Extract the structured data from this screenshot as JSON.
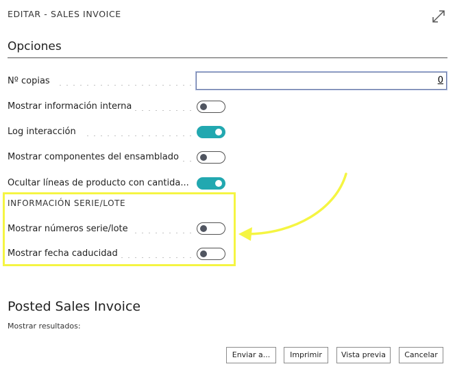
{
  "dialog": {
    "title": "EDITAR - SALES INVOICE"
  },
  "options": {
    "section_title": "Opciones",
    "copies": {
      "label": "Nº copias",
      "value": "0"
    },
    "toggles": [
      {
        "label": "Mostrar información interna",
        "state": "off"
      },
      {
        "label": "Log interacción",
        "state": "on"
      },
      {
        "label": "Mostrar componentes del ensamblado",
        "state": "off"
      },
      {
        "label": "Ocultar líneas de producto con cantida...",
        "state": "on"
      }
    ]
  },
  "serial_lot": {
    "title": "INFORMACIÓN SERIE/LOTE",
    "toggles": [
      {
        "label": "Mostrar números serie/lote",
        "state": "off"
      },
      {
        "label": "Mostrar fecha caducidad",
        "state": "off"
      }
    ]
  },
  "report": {
    "title": "Posted Sales Invoice",
    "subtitle": "Mostrar resultados:"
  },
  "buttons": {
    "send": "Enviar a...",
    "print": "Imprimir",
    "preview": "Vista previa",
    "cancel": "Cancelar"
  },
  "colors": {
    "toggle_on": "#22a8b0",
    "highlight": "#f5f542"
  },
  "icons": {
    "expand": "expand-icon"
  }
}
